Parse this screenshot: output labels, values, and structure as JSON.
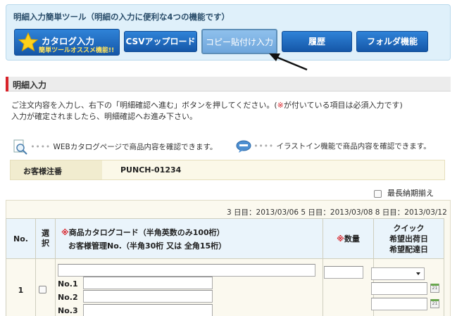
{
  "toolbar": {
    "title": "明細入力簡単ツール（明細の入力に便利な4つの機能です）",
    "buttons": {
      "catalog": "カタログ入力",
      "catalog_sub": "簡単ツールオススメ機能!!",
      "csv": "CSVアップロード",
      "copy": "コピー貼付け入力",
      "history": "履歴",
      "folder": "フォルダ機能"
    }
  },
  "section": {
    "title": "明細入力",
    "desc1_a": "ご注文内容を入力し、右下の「明細確認へ進む」ボタンを押してください。(",
    "desc1_red": "※",
    "desc1_b": "が付いている項目は必須入力です)",
    "desc2": "入力が確定されましたら、明細確認へお進み下さい。"
  },
  "info": {
    "web_catalog": "WEBカタログページで商品内容を確認できます。",
    "illustrain": "イラストイン機能で商品内容を確認できます。"
  },
  "order": {
    "label": "お客様注番",
    "value": "PUNCH-01234"
  },
  "option": {
    "longest_delivery": "最長納期揃え"
  },
  "dates": "3 日目：2013/03/06  5 日目：2013/03/08  8 日目：2013/03/12",
  "table": {
    "headers": {
      "no": "No.",
      "select": "選択",
      "code_mark": "※",
      "code_line1": "商品カタログコード（半角英数のみ100桁）",
      "code_line2": "お客様管理No.（半角30桁 又は 全角15桁）",
      "qty_mark": "※",
      "qty": "数量",
      "quick1": "クイック",
      "quick2": "希望出荷日",
      "quick3": "希望配達日"
    },
    "rows": [
      {
        "no": "1",
        "no_labels": [
          "No.1",
          "No.2",
          "No.3"
        ]
      }
    ]
  }
}
